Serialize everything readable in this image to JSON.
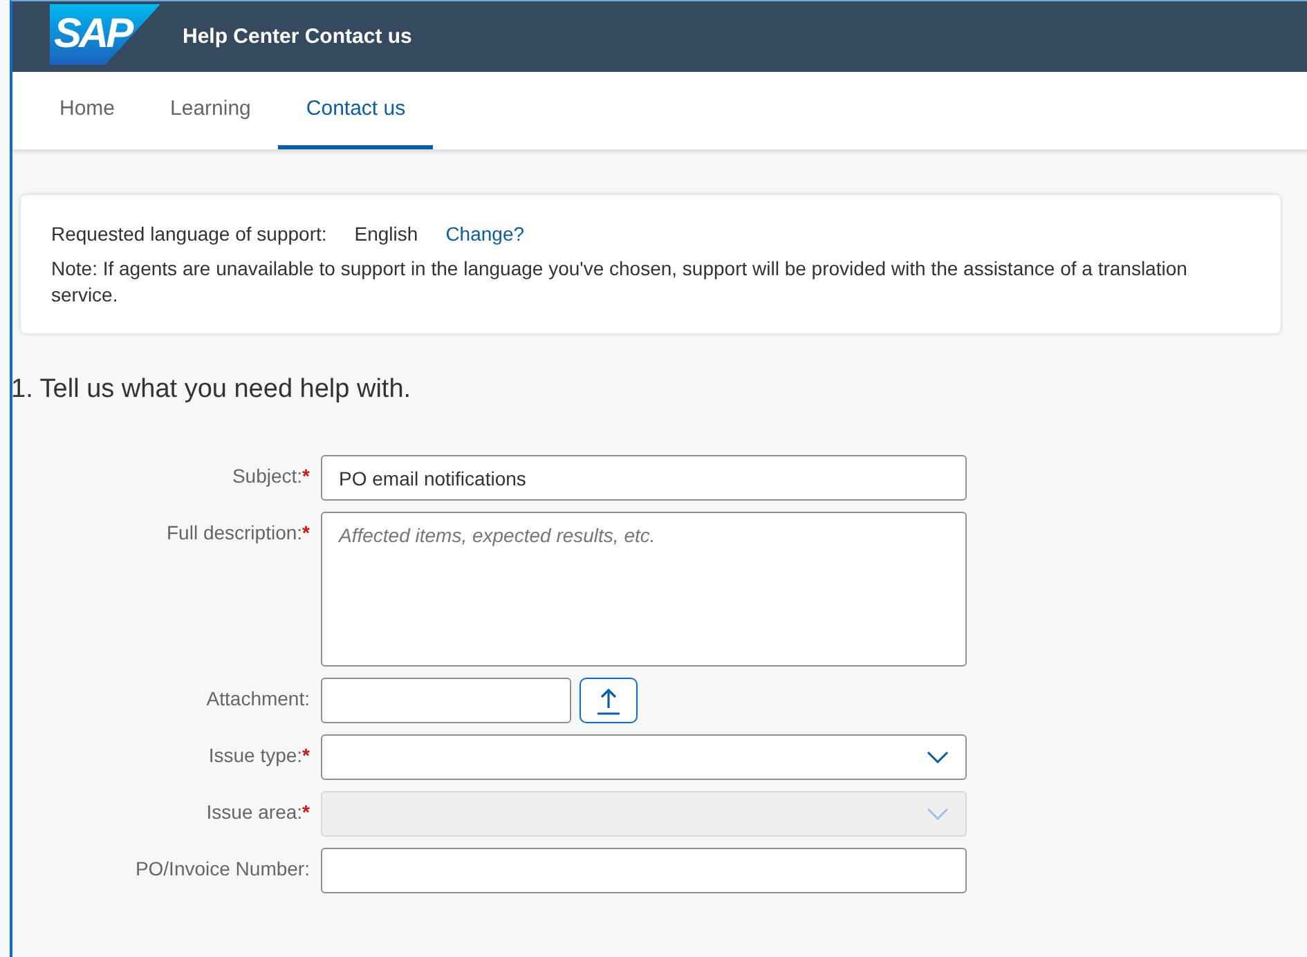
{
  "header": {
    "logo": "SAP",
    "title": "Help Center Contact us"
  },
  "tabs": [
    {
      "label": "Home",
      "selected": false
    },
    {
      "label": "Learning",
      "selected": false
    },
    {
      "label": "Contact us",
      "selected": true
    }
  ],
  "language_card": {
    "label": "Requested language of support:",
    "language": "English",
    "change_link": "Change?",
    "note": "Note: If agents are unavailable to support in the language you've chosen, support will be provided with the assistance of a translation service."
  },
  "section_title": "1. Tell us what you need help with.",
  "fields": [
    {
      "kind": "text",
      "label": "Subject:",
      "mark": "*",
      "value": "PO email notifications"
    },
    {
      "kind": "textarea",
      "label": "Full description:",
      "mark": "*",
      "placeholder": "Affected items, expected results, etc."
    },
    {
      "kind": "file",
      "label": "Attachment:"
    },
    {
      "kind": "select",
      "label": "Issue type:",
      "mark": "*",
      "disabled": false
    },
    {
      "kind": "select",
      "label": "Issue area:",
      "mark": "*",
      "disabled": true
    },
    {
      "kind": "text",
      "label": "PO/Invoice Number:"
    }
  ]
}
